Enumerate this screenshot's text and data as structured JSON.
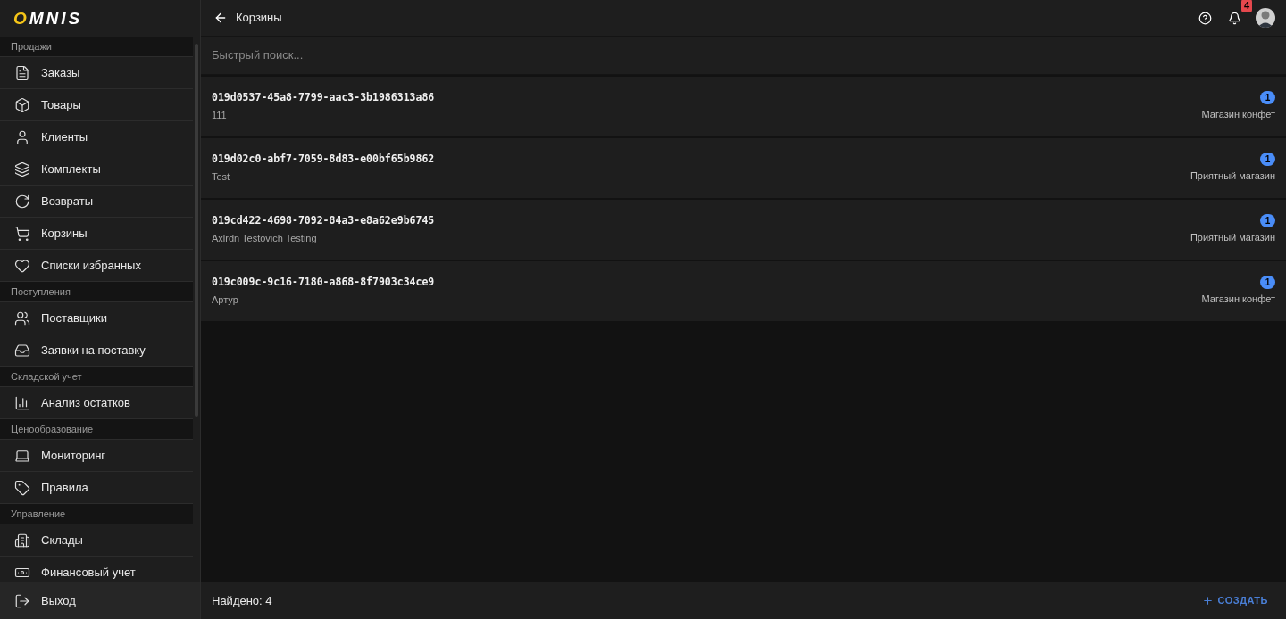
{
  "logo": {
    "text": "OMNIS"
  },
  "sidebar": {
    "sections": [
      {
        "title": "Продажи",
        "items": [
          {
            "label": "Заказы"
          },
          {
            "label": "Товары"
          },
          {
            "label": "Клиенты"
          },
          {
            "label": "Комплекты"
          },
          {
            "label": "Возвраты"
          },
          {
            "label": "Корзины"
          },
          {
            "label": "Списки избранных"
          }
        ]
      },
      {
        "title": "Поступления",
        "items": [
          {
            "label": "Поставщики"
          },
          {
            "label": "Заявки на поставку"
          }
        ]
      },
      {
        "title": "Складской учет",
        "items": [
          {
            "label": "Анализ остатков"
          }
        ]
      },
      {
        "title": "Ценообразование",
        "items": [
          {
            "label": "Мониторинг"
          },
          {
            "label": "Правила"
          }
        ]
      },
      {
        "title": "Управление",
        "items": [
          {
            "label": "Склады"
          },
          {
            "label": "Финансовый учет"
          }
        ]
      }
    ],
    "logout": "Выход"
  },
  "header": {
    "title": "Корзины",
    "notifications": "4"
  },
  "search": {
    "placeholder": "Быстрый поиск..."
  },
  "carts": [
    {
      "id": "019d0537-45a8-7799-aac3-3b1986313a86",
      "customer": "111",
      "count": "1",
      "store": "Магазин конфет"
    },
    {
      "id": "019d02c0-abf7-7059-8d83-e00bf65b9862",
      "customer": "Test",
      "count": "1",
      "store": "Приятный магазин"
    },
    {
      "id": "019cd422-4698-7092-84a3-e8a62e9b6745",
      "customer": "Axlrdn Testovich Testing",
      "count": "1",
      "store": "Приятный магазин"
    },
    {
      "id": "019c009c-9c16-7180-a868-8f7903c34ce9",
      "customer": "Артур",
      "count": "1",
      "store": "Магазин конфет"
    }
  ],
  "footer": {
    "found": "Найдено: 4",
    "create": "СОЗДАТЬ"
  }
}
